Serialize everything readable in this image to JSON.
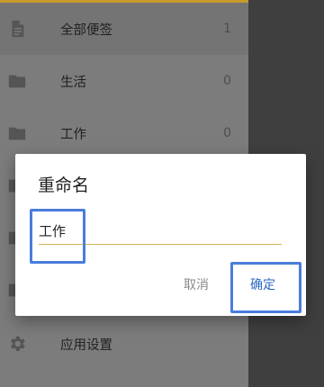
{
  "drawer": {
    "items": [
      {
        "label": "全部便签",
        "count": "1",
        "icon": "note-icon"
      },
      {
        "label": "生活",
        "count": "0",
        "icon": "folder-icon"
      },
      {
        "label": "工作",
        "count": "0",
        "icon": "folder-icon"
      },
      {
        "label": "",
        "count": "",
        "icon": "folder-icon"
      },
      {
        "label": "",
        "count": "",
        "icon": "folder-icon"
      },
      {
        "label": "",
        "count": "",
        "icon": "folder-icon"
      },
      {
        "label": "应用设置",
        "count": "",
        "icon": "gear-icon"
      }
    ]
  },
  "dialog": {
    "title": "重命名",
    "input_value": "工作",
    "cancel_label": "取消",
    "confirm_label": "确定"
  },
  "colors": {
    "accent": "#c79a2e",
    "confirm": "#2b67bf",
    "input_underline": "#d8b45a",
    "highlight_box": "#4a7ddc"
  }
}
